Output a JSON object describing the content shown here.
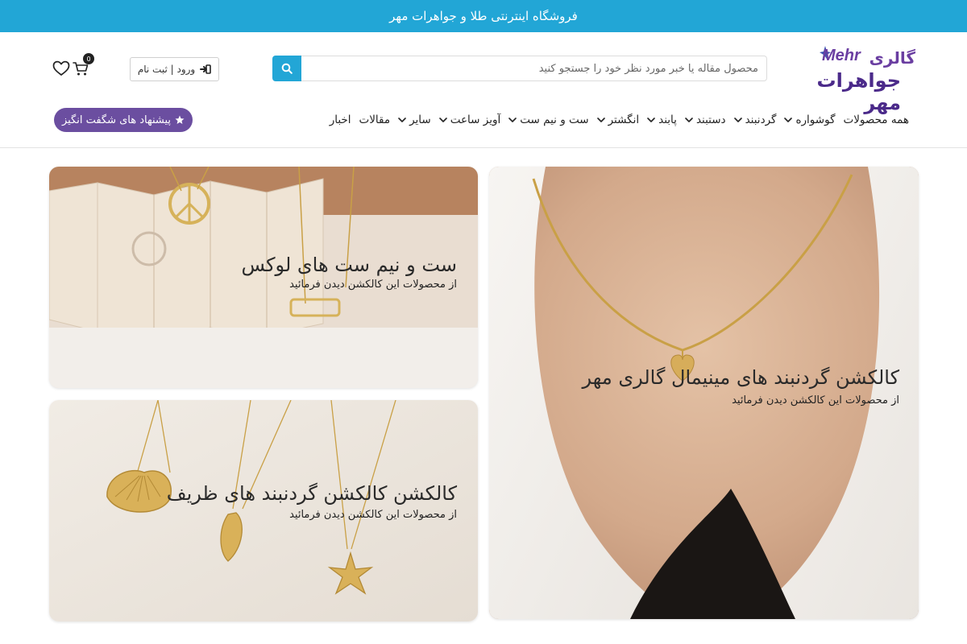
{
  "banner": {
    "text": "فروشگاه اینترنتی طلا و جواهرات مهر"
  },
  "logo": {
    "latin": "Mehr",
    "gallery": "گالری",
    "jewels": "جواهرات مهر"
  },
  "search": {
    "placeholder": "محصول مقاله یا خبر مورد نظر خود را جستجو کنید",
    "value": ""
  },
  "account": {
    "login_label": "ورود | ثبت نام"
  },
  "cart": {
    "count": "0"
  },
  "nav": {
    "items": [
      {
        "label": "همه محصولات",
        "has_dropdown": false
      },
      {
        "label": "گوشواره",
        "has_dropdown": true
      },
      {
        "label": "گردنبند",
        "has_dropdown": true
      },
      {
        "label": "دستبند",
        "has_dropdown": true
      },
      {
        "label": "پابند",
        "has_dropdown": true
      },
      {
        "label": "انگشتر",
        "has_dropdown": true
      },
      {
        "label": "ست و نیم ست",
        "has_dropdown": true
      },
      {
        "label": "آویز ساعت",
        "has_dropdown": true
      },
      {
        "label": "سایر",
        "has_dropdown": true
      },
      {
        "label": "مقالات",
        "has_dropdown": false
      },
      {
        "label": "اخبار",
        "has_dropdown": false
      }
    ],
    "promo_label": "پیشنهاد های شگفت انگیز"
  },
  "collections": {
    "minimal": {
      "title": "کالکشن گردنبند های مینیمال گالری مهر",
      "subtitle": "از محصولات این کالکشن دیدن فرمائید"
    },
    "lux": {
      "title": "ست و نیم ست های لوکس",
      "subtitle": "از محصولات این کالکشن دیدن فرمائید"
    },
    "delicate": {
      "title": "کالکشن کالکشن گردنبند های ظریف",
      "subtitle": "از محصولات این کالکشن دیدن فرمائید"
    }
  },
  "colors": {
    "accent": "#22a6d6",
    "promo": "#6b4ea0",
    "logo": "#6a3ea1"
  }
}
